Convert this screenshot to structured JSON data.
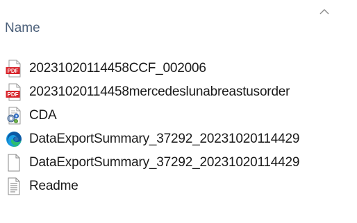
{
  "header": {
    "name_column": "Name",
    "sort_direction": "ascending"
  },
  "files": [
    {
      "name": "20231020114458CCF_002006",
      "icon": "pdf-file-icon"
    },
    {
      "name": "20231020114458mercedeslunabreastusorder",
      "icon": "pdf-file-icon"
    },
    {
      "name": "CDA",
      "icon": "config-file-icon"
    },
    {
      "name": "DataExportSummary_37292_20231020114429",
      "icon": "edge-browser-icon"
    },
    {
      "name": "DataExportSummary_37292_20231020114429",
      "icon": "blank-file-icon"
    },
    {
      "name": "Readme",
      "icon": "text-file-icon"
    }
  ],
  "icons": {
    "pdf": {
      "label": "PDF",
      "color": "#d8232a"
    },
    "edge_colors": [
      "#0c59a4",
      "#2ebd6f",
      "#1b9de2"
    ],
    "config_accent": "#3a7bd5"
  }
}
